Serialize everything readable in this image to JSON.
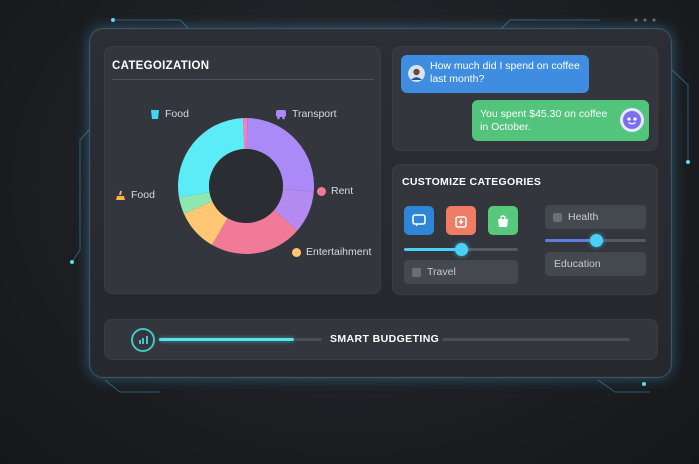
{
  "categorization": {
    "title": "CATEGOIZATION",
    "segments": [
      {
        "name": "Transport",
        "value": 26,
        "color": "#a98af7"
      },
      {
        "name": "Rent",
        "value": 10,
        "color": "#b489f0"
      },
      {
        "name": "Entertaihment",
        "value": 22,
        "color": "#f07a98"
      },
      {
        "name": "Food",
        "value": 10,
        "color": "#ffc774"
      },
      {
        "name": "Food",
        "value": 4,
        "color": "#8ee7b0"
      },
      {
        "name": "Food",
        "value": 27,
        "color": "#5cecf8"
      },
      {
        "name": "",
        "value": 1,
        "color": "#ff7bc0"
      }
    ],
    "labels": [
      {
        "text": "Food",
        "icon": "cup-icon",
        "color": "#45d6f2"
      },
      {
        "text": "Transport",
        "icon": "bus-icon",
        "color": "#a98af7"
      },
      {
        "text": "Food",
        "icon": "food-icon",
        "color": "#ffb347"
      },
      {
        "text": "Rent",
        "icon": "dot-icon",
        "color": "#f07a98"
      },
      {
        "text": "Entertaihment",
        "icon": "dot-icon",
        "color": "#ffc774"
      }
    ]
  },
  "chat": {
    "question": "How much did I spend on coffee last month?",
    "answer": "You spent $45.30 on coffee in October."
  },
  "customize": {
    "title": "CUSTOMIZE CATEGORIES",
    "buttons": [
      {
        "icon": "chat-icon",
        "color": "#2f86d6"
      },
      {
        "icon": "wallet-icon",
        "color": "#ef7d63"
      },
      {
        "icon": "basket-icon",
        "color": "#58c97c"
      }
    ],
    "slider_left_level": 0.5,
    "slider_right_level": 0.5,
    "chips": [
      "Travel",
      "Health",
      "Education"
    ]
  },
  "budgeting": {
    "label": "SMART BUDGETING",
    "progress": 0.4
  }
}
